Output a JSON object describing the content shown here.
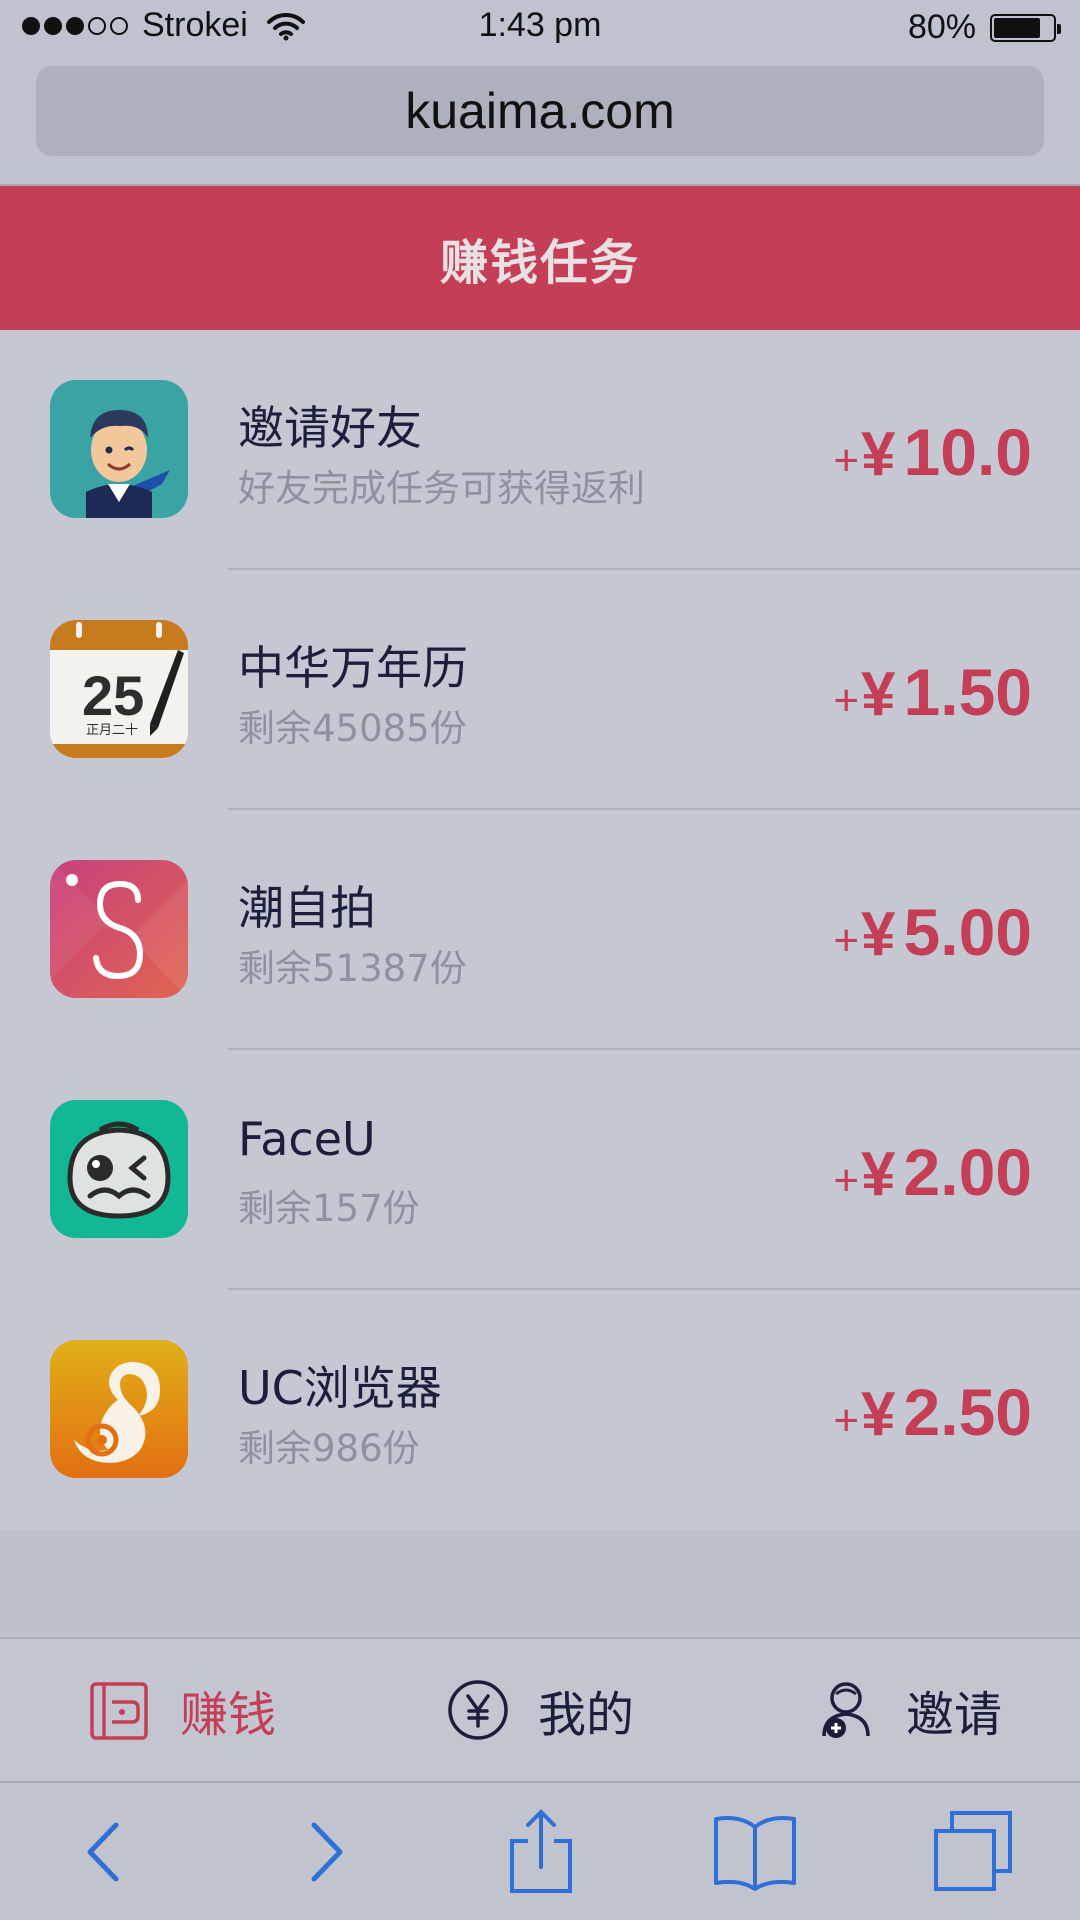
{
  "status_bar": {
    "signal_filled": 3,
    "signal_total": 5,
    "carrier": "Strokei",
    "time": "1:43 pm",
    "battery_percent": "80%",
    "battery_level": 0.8
  },
  "browser": {
    "url": "kuaima.com"
  },
  "header": {
    "title": "赚钱任务"
  },
  "tasks": [
    {
      "title": "邀请好友",
      "subtitle": "好友完成任务可获得返利",
      "plus": "+",
      "currency": "¥",
      "amount": "10.0",
      "icon": "invite-friend-icon"
    },
    {
      "title": "中华万年历",
      "subtitle": "剩余45085份",
      "plus": "+",
      "currency": "¥",
      "amount": "1.50",
      "icon": "calendar-app-icon",
      "icon_text_day": "25",
      "icon_text_lunar": "正月二十"
    },
    {
      "title": "潮自拍",
      "subtitle": "剩余51387份",
      "plus": "+",
      "currency": "¥",
      "amount": "5.00",
      "icon": "chao-selfie-app-icon"
    },
    {
      "title": "FaceU",
      "subtitle": "剩余157份",
      "plus": "+",
      "currency": "¥",
      "amount": "2.00",
      "icon": "faceu-app-icon"
    },
    {
      "title": "UC浏览器",
      "subtitle": "剩余986份",
      "plus": "+",
      "currency": "¥",
      "amount": "2.50",
      "icon": "uc-browser-app-icon"
    }
  ],
  "tab_bar": {
    "earn": {
      "label": "赚钱",
      "icon": "wallet-icon",
      "active": true
    },
    "mine": {
      "label": "我的",
      "icon": "yen-circle-icon",
      "active": false
    },
    "invite": {
      "label": "邀请",
      "icon": "add-user-icon",
      "active": false
    }
  },
  "toolbar": {
    "back": "back-arrow-icon",
    "forward": "forward-arrow-icon",
    "share": "share-icon",
    "bookmarks": "bookmarks-book-icon",
    "tabs": "tabs-icon"
  },
  "colors": {
    "accent": "#c43f56",
    "toolbar_blue": "#2f6fd6",
    "text_dark": "#1a1f3c",
    "text_muted": "#8f919e"
  }
}
